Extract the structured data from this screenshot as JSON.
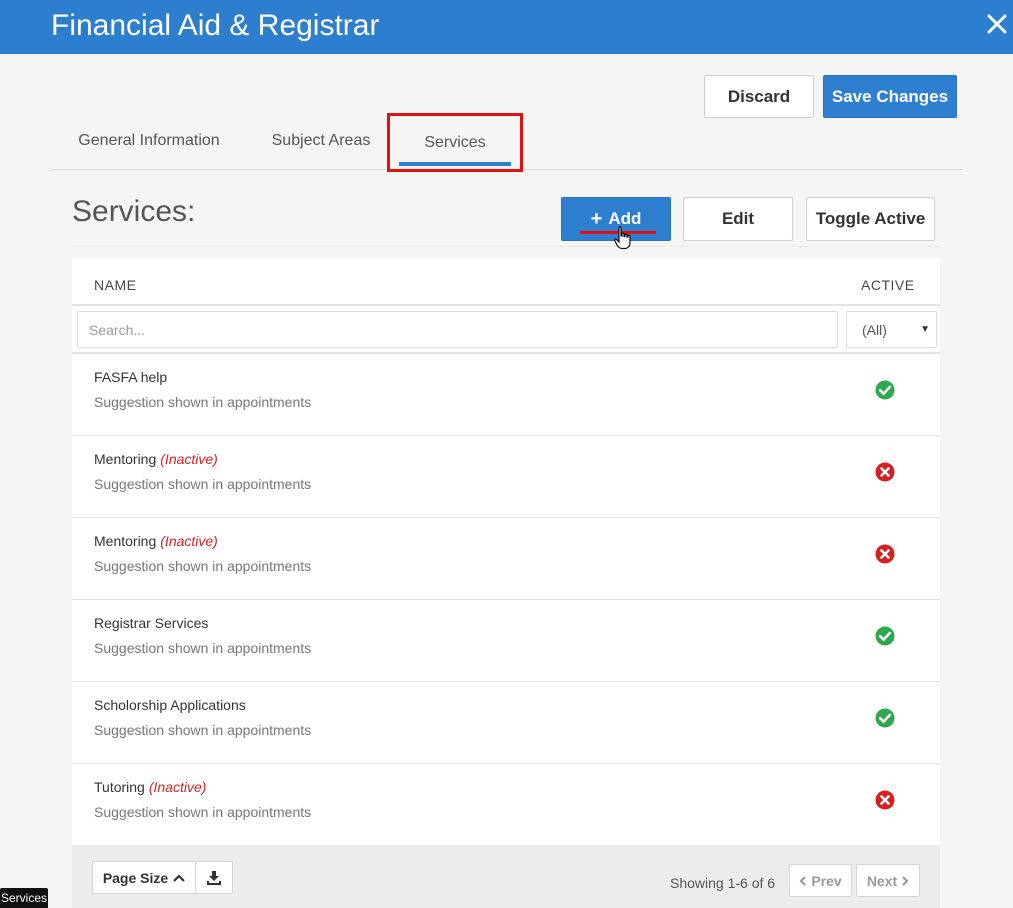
{
  "window": {
    "title": "Financial Aid & Registrar",
    "close_icon": "close-icon"
  },
  "actions": {
    "discard_label": "Discard",
    "save_label": "Save Changes"
  },
  "tabs": [
    {
      "label": "General Information",
      "active": false
    },
    {
      "label": "Subject Areas",
      "active": false
    },
    {
      "label": "Services",
      "active": true
    }
  ],
  "section": {
    "title": "Services:",
    "add_label": "Add",
    "edit_label": "Edit",
    "toggle_label": "Toggle Active"
  },
  "table": {
    "columns": {
      "name": "NAME",
      "active": "ACTIVE"
    },
    "search_placeholder": "Search...",
    "active_filter": "(All)",
    "inactive_tag": "(Inactive)",
    "rows": [
      {
        "name": "FASFA help",
        "inactive": false,
        "description": "Suggestion shown in appointments",
        "active": true
      },
      {
        "name": "Mentoring",
        "inactive": true,
        "description": "Suggestion shown in appointments",
        "active": false
      },
      {
        "name": "Mentoring",
        "inactive": true,
        "description": "Suggestion shown in appointments",
        "active": false
      },
      {
        "name": "Registrar Services",
        "inactive": false,
        "description": "Suggestion shown in appointments",
        "active": true
      },
      {
        "name": "Scholorship Applications",
        "inactive": false,
        "description": "Suggestion shown in appointments",
        "active": true
      },
      {
        "name": "Tutoring",
        "inactive": true,
        "description": "Suggestion shown in appointments",
        "active": false
      }
    ]
  },
  "footer": {
    "page_size_label": "Page Size",
    "showing": "Showing 1-6 of 6",
    "prev_label": "Prev",
    "next_label": "Next"
  },
  "tooltip": "Services",
  "colors": {
    "brand": "#2e7ecf",
    "active": "#2ea84f",
    "inactive": "#d42020",
    "highlight": "#e21010"
  }
}
